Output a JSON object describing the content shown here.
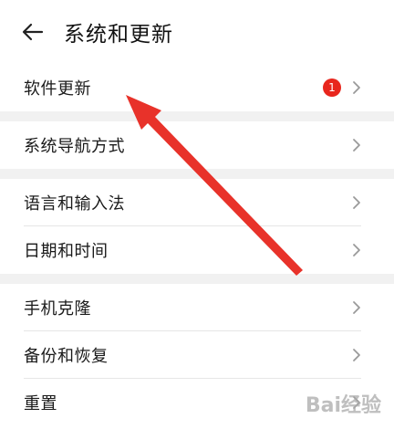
{
  "header": {
    "title": "系统和更新",
    "back_icon": "back-arrow-icon"
  },
  "groups": [
    [
      {
        "label": "软件更新",
        "badge": "1"
      }
    ],
    [
      {
        "label": "系统导航方式"
      }
    ],
    [
      {
        "label": "语言和输入法"
      },
      {
        "label": "日期和时间"
      }
    ],
    [
      {
        "label": "手机克隆"
      },
      {
        "label": "备份和恢复"
      },
      {
        "label": "重置"
      }
    ]
  ],
  "colors": {
    "badge": "#e8261d",
    "annotation_arrow": "#e8322a",
    "divider": "#f1f1f1"
  },
  "watermark": "Bai经验"
}
